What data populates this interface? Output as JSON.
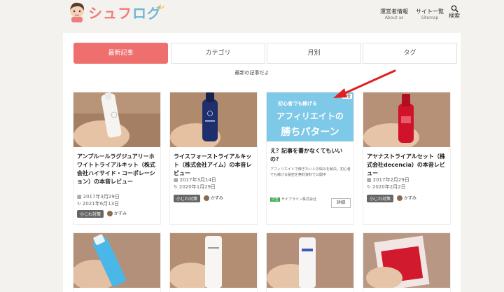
{
  "header": {
    "logo_text_a": "シュフ",
    "logo_text_b": "ログ",
    "nav": [
      {
        "label": "運営者情報",
        "sub": "About us"
      },
      {
        "label": "サイト一覧",
        "sub": "Sitemap"
      },
      {
        "label": "検索",
        "icon": "search-icon"
      }
    ]
  },
  "tabs": [
    {
      "label": "最新記事",
      "active": true
    },
    {
      "label": "カテゴリ"
    },
    {
      "label": "月別"
    },
    {
      "label": "タグ"
    }
  ],
  "caption": "最新の記事だよ",
  "articles": [
    {
      "title": "アンプルールラグジュアリーホワイトトライアルキット（株式会社ハイサイド・コーポレーション）の本音レビュー",
      "published": "2017年3月29日",
      "updated": "2021年6月13日",
      "category": "小じわ対策",
      "author": "かずみ"
    },
    {
      "title": "ライスフォーストライアルキット（株式会社アイム）の本音レビュー",
      "published": "2017年3月14日",
      "updated": "2020年1月29日",
      "category": "小じわ対策",
      "author": "かずみ"
    },
    {
      "title": "アヤナストライアルセット（株式会社decencia）の本音レビュー",
      "published": "2017年2月29日",
      "updated": "2020年2月2日",
      "category": "小じわ対策",
      "author": "かずみ"
    }
  ],
  "ad": {
    "banner_small": "初心者でも稼げる",
    "banner_mark": "広告",
    "banner_line1": "アフィリエイトの",
    "banner_line2": "勝ちパターン",
    "title": "え？記事を書かなくてもいいの？",
    "description": "アフィリエイトで稼ぎたい人の悩みを解決。初心者でも稼げる秘密を無料資料で公開中",
    "sponsor_badge": "広告",
    "sponsor": "サイアライン株式会社",
    "button": "詳細"
  },
  "colors": {
    "accent": "#ef6f6f",
    "background": "#f4f2ef",
    "ad_banner": "#7ec8e8",
    "arrow": "#e02020"
  }
}
